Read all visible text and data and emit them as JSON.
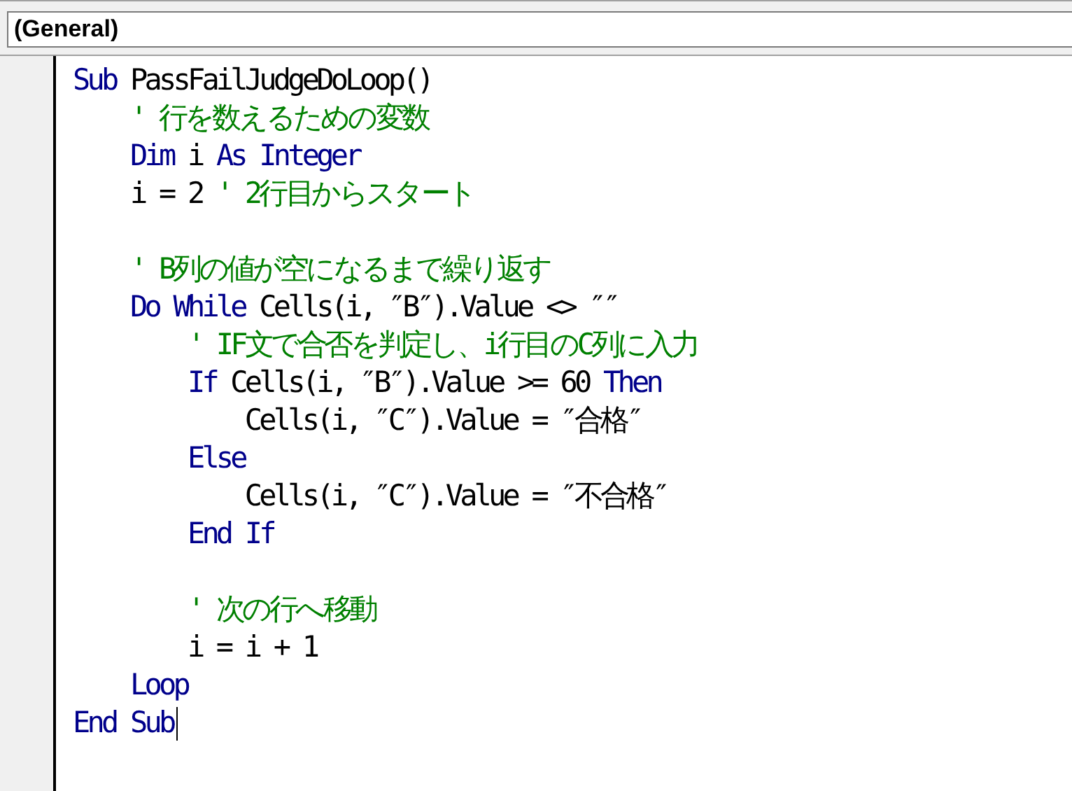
{
  "object_box": {
    "value": "(General)"
  },
  "code_lines": [
    {
      "kind": "code",
      "tokens": [
        {
          "kind": "keyword",
          "text": "Sub"
        },
        {
          "kind": "plain",
          "text": " PassFailJudgeDoLoop()"
        }
      ]
    },
    {
      "kind": "code",
      "tokens": [
        {
          "kind": "comment",
          "text": "    ' 行を数えるための変数"
        }
      ]
    },
    {
      "kind": "code",
      "tokens": [
        {
          "kind": "keyword",
          "text": "    Dim"
        },
        {
          "kind": "plain",
          "text": " i "
        },
        {
          "kind": "keyword",
          "text": "As Integer"
        }
      ]
    },
    {
      "kind": "code",
      "tokens": [
        {
          "kind": "plain",
          "text": "    i = 2 "
        },
        {
          "kind": "comment",
          "text": "' 2行目からスタート"
        }
      ]
    },
    {
      "kind": "blank"
    },
    {
      "kind": "code",
      "tokens": [
        {
          "kind": "comment",
          "text": "    ' B列の値が空になるまで繰り返す"
        }
      ]
    },
    {
      "kind": "code",
      "tokens": [
        {
          "kind": "keyword",
          "text": "    Do While"
        },
        {
          "kind": "plain",
          "text": " Cells(i, ″B″).Value <> ″″"
        }
      ]
    },
    {
      "kind": "code",
      "tokens": [
        {
          "kind": "comment",
          "text": "        ' IF文で合否を判定し、i行目のC列に入力"
        }
      ]
    },
    {
      "kind": "code",
      "tokens": [
        {
          "kind": "keyword",
          "text": "        If"
        },
        {
          "kind": "plain",
          "text": " Cells(i, ″B″).Value >= 60 "
        },
        {
          "kind": "keyword",
          "text": "Then"
        }
      ]
    },
    {
      "kind": "code",
      "tokens": [
        {
          "kind": "plain",
          "text": "            Cells(i, ″C″).Value = ″合格″"
        }
      ]
    },
    {
      "kind": "code",
      "tokens": [
        {
          "kind": "keyword",
          "text": "        Else"
        }
      ]
    },
    {
      "kind": "code",
      "tokens": [
        {
          "kind": "plain",
          "text": "            Cells(i, ″C″).Value = ″不合格″"
        }
      ]
    },
    {
      "kind": "code",
      "tokens": [
        {
          "kind": "keyword",
          "text": "        End If"
        }
      ]
    },
    {
      "kind": "blank"
    },
    {
      "kind": "code",
      "tokens": [
        {
          "kind": "comment",
          "text": "        ' 次の行へ移動"
        }
      ]
    },
    {
      "kind": "code",
      "tokens": [
        {
          "kind": "plain",
          "text": "        i = i + 1"
        }
      ]
    },
    {
      "kind": "code",
      "tokens": [
        {
          "kind": "keyword",
          "text": "    Loop"
        }
      ]
    },
    {
      "kind": "code",
      "tokens": [
        {
          "kind": "keyword",
          "text": "End Sub"
        }
      ]
    }
  ]
}
